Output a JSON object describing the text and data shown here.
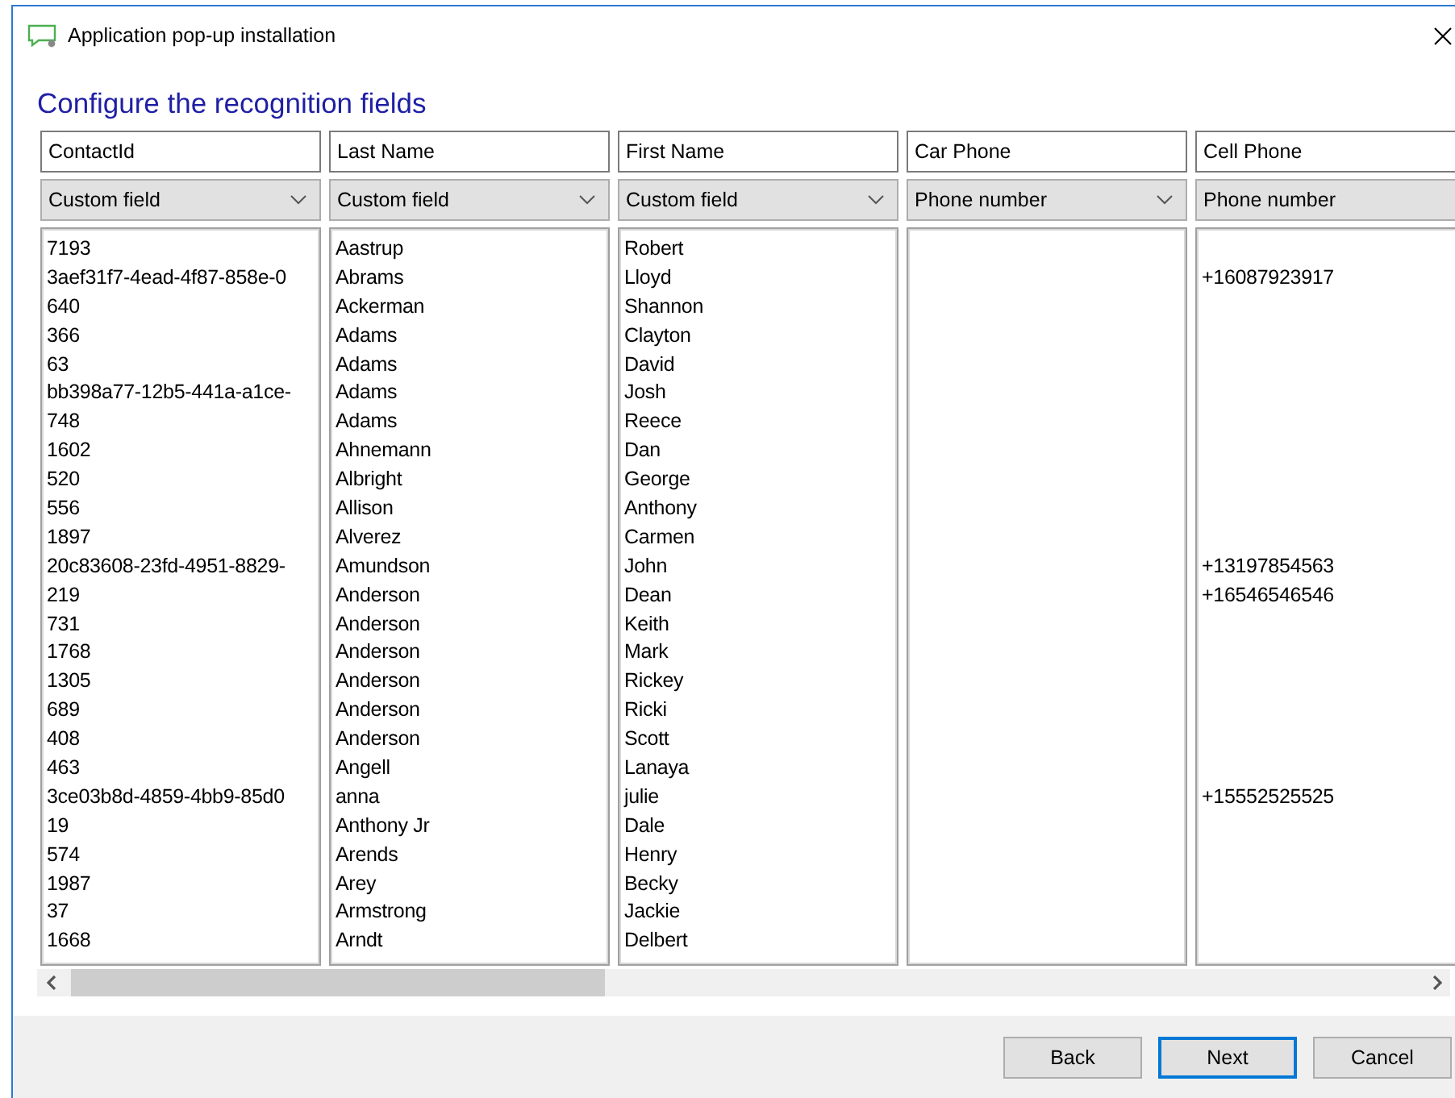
{
  "window": {
    "title": "Application pop-up installation"
  },
  "heading": "Configure the recognition fields",
  "columns": [
    {
      "header": "ContactId",
      "mapping": "Custom field"
    },
    {
      "header": "Last Name",
      "mapping": "Custom field"
    },
    {
      "header": "First Name",
      "mapping": "Custom field"
    },
    {
      "header": "Car Phone",
      "mapping": "Phone number"
    },
    {
      "header": "Cell Phone",
      "mapping": "Phone number"
    }
  ],
  "rows": [
    {
      "contact_id": "7193",
      "last_name": "Aastrup",
      "first_name": "Robert"
    },
    {
      "contact_id": "3aef31f7-4ead-4f87-858e-0",
      "last_name": "Abrams",
      "first_name": "Lloyd",
      "cell_phone": "+16087923917"
    },
    {
      "contact_id": "640",
      "last_name": "Ackerman",
      "first_name": "Shannon"
    },
    {
      "contact_id": "366",
      "last_name": "Adams",
      "first_name": "Clayton"
    },
    {
      "contact_id": "63",
      "last_name": "Adams",
      "first_name": "David"
    },
    {
      "contact_id": "bb398a77-12b5-441a-a1ce-",
      "last_name": "Adams",
      "first_name": "Josh"
    },
    {
      "contact_id": "748",
      "last_name": "Adams",
      "first_name": "Reece"
    },
    {
      "contact_id": "1602",
      "last_name": "Ahnemann",
      "first_name": "Dan"
    },
    {
      "contact_id": "520",
      "last_name": "Albright",
      "first_name": "George"
    },
    {
      "contact_id": "556",
      "last_name": "Allison",
      "first_name": "Anthony"
    },
    {
      "contact_id": "1897",
      "last_name": "Alverez",
      "first_name": "Carmen"
    },
    {
      "contact_id": "20c83608-23fd-4951-8829-",
      "last_name": "Amundson",
      "first_name": "John",
      "cell_phone": "+13197854563"
    },
    {
      "contact_id": "219",
      "last_name": "Anderson",
      "first_name": "Dean",
      "cell_phone": "+16546546546"
    },
    {
      "contact_id": "731",
      "last_name": "Anderson",
      "first_name": "Keith"
    },
    {
      "contact_id": "1768",
      "last_name": "Anderson",
      "first_name": "Mark"
    },
    {
      "contact_id": "1305",
      "last_name": "Anderson",
      "first_name": "Rickey"
    },
    {
      "contact_id": "689",
      "last_name": "Anderson",
      "first_name": "Ricki"
    },
    {
      "contact_id": "408",
      "last_name": "Anderson",
      "first_name": "Scott"
    },
    {
      "contact_id": "463",
      "last_name": "Angell",
      "first_name": "Lanaya"
    },
    {
      "contact_id": "3ce03b8d-4859-4bb9-85d0",
      "last_name": "anna",
      "first_name": "julie",
      "cell_phone": "+15552525525"
    },
    {
      "contact_id": "19",
      "last_name": "Anthony Jr",
      "first_name": "Dale"
    },
    {
      "contact_id": "574",
      "last_name": "Arends",
      "first_name": "Henry"
    },
    {
      "contact_id": "1987",
      "last_name": "Arey",
      "first_name": "Becky"
    },
    {
      "contact_id": "37",
      "last_name": "Armstrong",
      "first_name": "Jackie"
    },
    {
      "contact_id": "1668",
      "last_name": "Arndt",
      "first_name": "Delbert"
    }
  ],
  "buttons": [
    {
      "label": "Back",
      "default": false
    },
    {
      "label": "Next",
      "default": true
    },
    {
      "label": "Cancel",
      "default": false
    }
  ]
}
